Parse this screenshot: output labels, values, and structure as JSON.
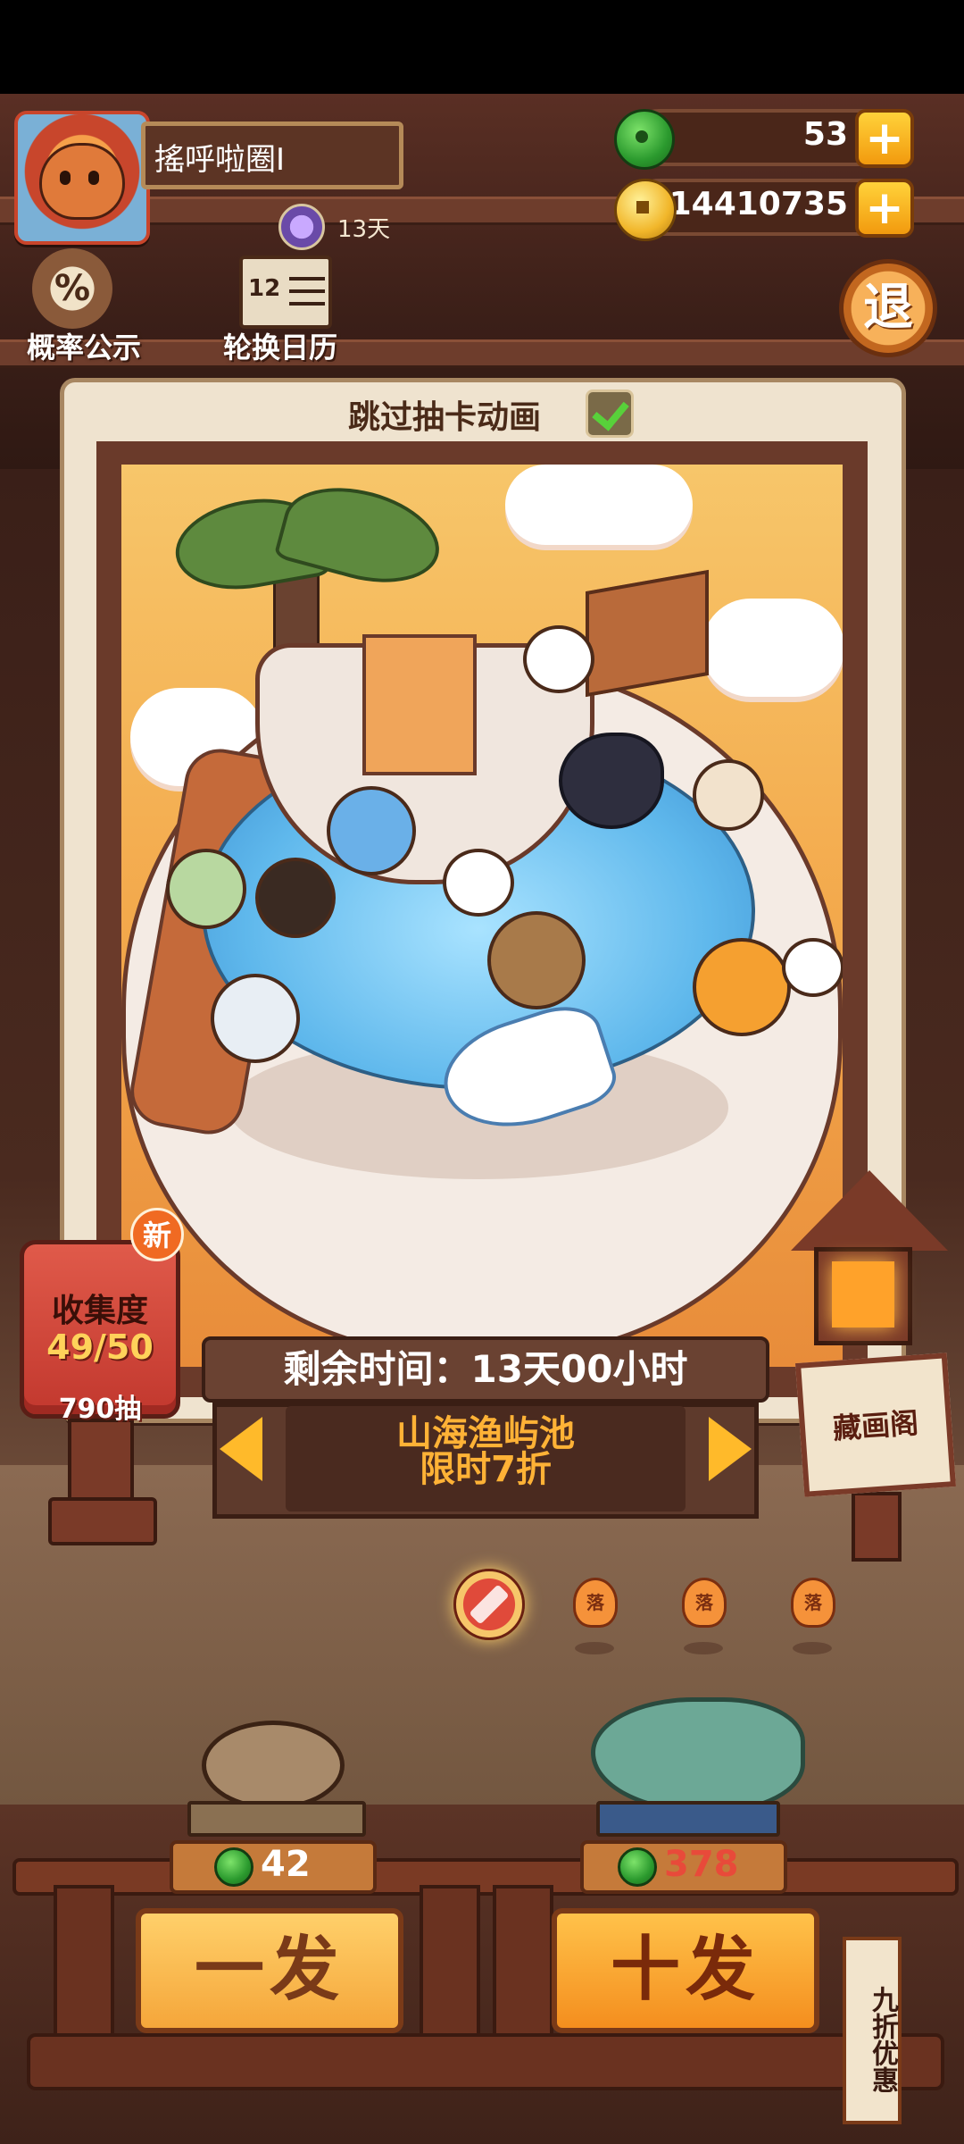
{
  "player": {
    "name": "搖呼啦圈I",
    "rank_days": "13天"
  },
  "currency": {
    "jade": "53",
    "coins": "14410735"
  },
  "side_buttons": {
    "probability": "概率公示",
    "probability_icon": "%",
    "calendar": "轮换日历",
    "calendar_icon": "12",
    "exit": "退"
  },
  "gacha": {
    "skip_animation": "跳过抽卡动画",
    "timer": "剩余时间：13天00小时",
    "pool_name": "山海渔屿池",
    "pool_discount": "限时7折"
  },
  "collection": {
    "new_badge": "新",
    "title": "收集度",
    "count": "49/50",
    "draws": "790抽"
  },
  "gallery": {
    "label": "藏画阁"
  },
  "page_dots": [
    {
      "label": ""
    },
    {
      "label": "落"
    },
    {
      "label": "落"
    },
    {
      "label": "落"
    }
  ],
  "draw": {
    "single_label": "一发",
    "single_cost": "42",
    "ten_label": "十发",
    "ten_cost": "378",
    "discount_tag": "九折优惠"
  },
  "colors": {
    "accent": "#ffb236",
    "cost_red": "#e84a3a",
    "jade": "#2b9a2e"
  }
}
